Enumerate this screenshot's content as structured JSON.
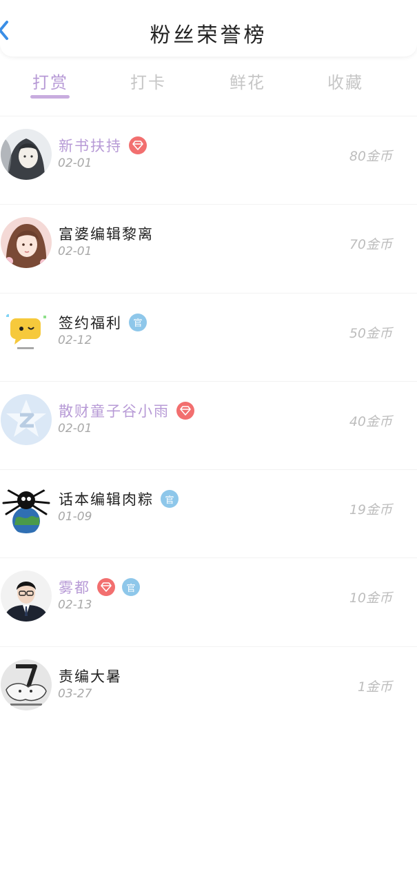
{
  "header": {
    "title": "粉丝荣誉榜"
  },
  "tabs": [
    {
      "label": "打赏",
      "active": true
    },
    {
      "label": "打卡",
      "active": false
    },
    {
      "label": "鲜花",
      "active": false
    },
    {
      "label": "收藏",
      "active": false
    }
  ],
  "fans": [
    {
      "name": "新书扶持",
      "date": "02-01",
      "amount": "80金币",
      "vip": true,
      "badges": [
        "diamond-icon"
      ],
      "avatar": "ink-portrait"
    },
    {
      "name": "富婆编辑黎离",
      "date": "02-01",
      "amount": "70金币",
      "vip": false,
      "badges": [],
      "avatar": "girl-portrait"
    },
    {
      "name": "签约福利",
      "date": "02-12",
      "amount": "50金币",
      "vip": false,
      "badges": [
        "official-icon"
      ],
      "avatar": "yellow-chat-bubble"
    },
    {
      "name": "散财童子谷小雨",
      "date": "02-01",
      "amount": "40金币",
      "vip": true,
      "badges": [
        "diamond-icon"
      ],
      "avatar": "blue-star-logo"
    },
    {
      "name": "话本编辑肉粽",
      "date": "01-09",
      "amount": "19金币",
      "vip": false,
      "badges": [
        "official-icon"
      ],
      "avatar": "spider-earth"
    },
    {
      "name": "雾都",
      "date": "02-13",
      "amount": "10金币",
      "vip": true,
      "badges": [
        "diamond-icon",
        "official-icon"
      ],
      "avatar": "man-in-suit"
    },
    {
      "name": "责编大暑",
      "date": "03-27",
      "amount": "1金币",
      "vip": false,
      "badges": [],
      "avatar": "cartoon-sketch"
    }
  ],
  "badge_labels": {
    "official": "官"
  },
  "colors": {
    "accent": "#b79ad6",
    "diamond": "#f26f6f",
    "official": "#8ec7ea",
    "back": "#3a8ee6"
  }
}
